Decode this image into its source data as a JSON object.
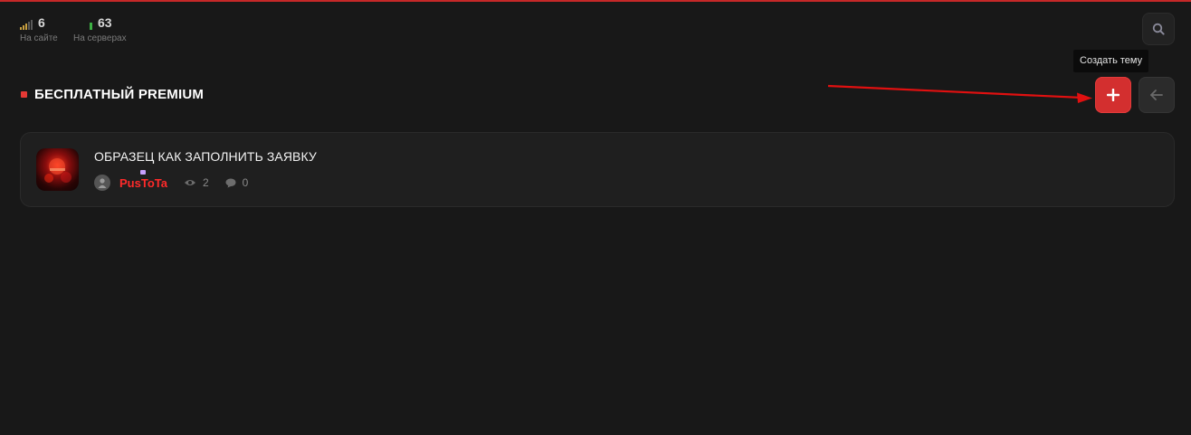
{
  "stats": {
    "site": {
      "value": "6",
      "label": "На сайте"
    },
    "servers": {
      "value": "63",
      "label": "На серверах"
    }
  },
  "search": {
    "icon": "search-icon"
  },
  "tooltip": {
    "text": "Создать тему"
  },
  "page": {
    "title": "БЕСПЛАТНЫЙ PREMIUM"
  },
  "actions": {
    "create_icon": "plus-icon",
    "back_icon": "arrow-left-icon"
  },
  "threads": [
    {
      "title": "ОБРАЗЕЦ КАК ЗАПОЛНИТЬ ЗАЯВКУ",
      "author": "PusToTa",
      "views": "2",
      "replies": "0"
    }
  ],
  "colors": {
    "accent": "#d32f2f",
    "background": "#181818",
    "card": "#1f1f1f",
    "author": "#ff2a2a",
    "online_site": "#c8a040",
    "online_servers": "#3cb043"
  }
}
